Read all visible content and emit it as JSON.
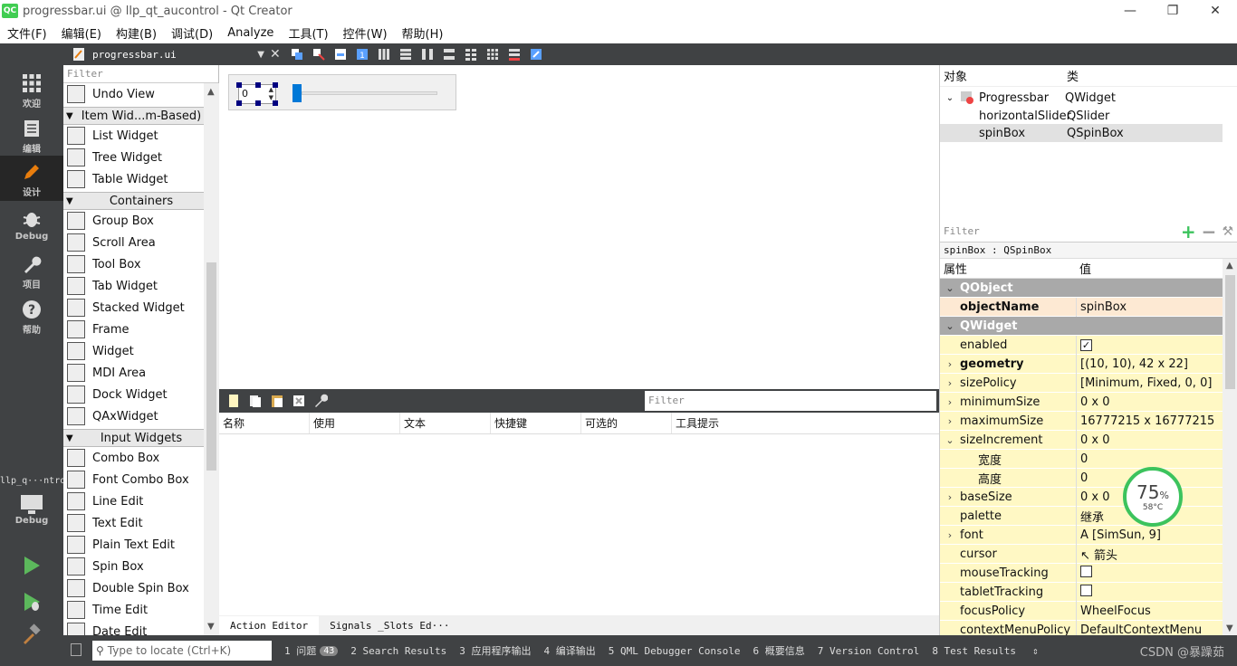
{
  "window": {
    "title": "progressbar.ui @ llp_qt_aucontrol - Qt Creator",
    "logo_text": "QC",
    "minimize_glyph": "—",
    "restore_glyph": "❐",
    "close_glyph": "✕"
  },
  "menu": [
    "文件(F)",
    "编辑(E)",
    "构建(B)",
    "调试(D)",
    "Analyze",
    "工具(T)",
    "控件(W)",
    "帮助(H)"
  ],
  "modes": [
    {
      "label": "欢迎",
      "icon": "grid-icon"
    },
    {
      "label": "编辑",
      "icon": "document-icon"
    },
    {
      "label": "设计",
      "icon": "pencil-icon",
      "active": true
    },
    {
      "label": "Debug",
      "icon": "bug-icon"
    },
    {
      "label": "项目",
      "icon": "wrench-icon"
    },
    {
      "label": "帮助",
      "icon": "help-icon"
    }
  ],
  "kit": {
    "name": "llp_q···ntrol",
    "mode": "Debug"
  },
  "toolbar": {
    "file_name": "progressbar.ui"
  },
  "widgetbox": {
    "filter_placeholder": "Filter",
    "items": [
      {
        "type": "item",
        "label": "Undo View"
      },
      {
        "type": "cat",
        "label": "Item Wid...m-Based)"
      },
      {
        "type": "item",
        "label": "List Widget"
      },
      {
        "type": "item",
        "label": "Tree Widget"
      },
      {
        "type": "item",
        "label": "Table Widget"
      },
      {
        "type": "cat",
        "label": "Containers"
      },
      {
        "type": "item",
        "label": "Group Box"
      },
      {
        "type": "item",
        "label": "Scroll Area"
      },
      {
        "type": "item",
        "label": "Tool Box"
      },
      {
        "type": "item",
        "label": "Tab Widget"
      },
      {
        "type": "item",
        "label": "Stacked Widget"
      },
      {
        "type": "item",
        "label": "Frame"
      },
      {
        "type": "item",
        "label": "Widget"
      },
      {
        "type": "item",
        "label": "MDI Area"
      },
      {
        "type": "item",
        "label": "Dock Widget"
      },
      {
        "type": "item",
        "label": "QAxWidget"
      },
      {
        "type": "cat",
        "label": "Input Widgets"
      },
      {
        "type": "item",
        "label": "Combo Box"
      },
      {
        "type": "item",
        "label": "Font Combo Box"
      },
      {
        "type": "item",
        "label": "Line Edit"
      },
      {
        "type": "item",
        "label": "Text Edit"
      },
      {
        "type": "item",
        "label": "Plain Text Edit"
      },
      {
        "type": "item",
        "label": "Spin Box"
      },
      {
        "type": "item",
        "label": "Double Spin Box"
      },
      {
        "type": "item",
        "label": "Time Edit"
      },
      {
        "type": "item",
        "label": "Date Edit"
      }
    ]
  },
  "form": {
    "spinbox_value": "0"
  },
  "action_editor": {
    "filter_placeholder": "Filter",
    "columns": [
      "名称",
      "使用",
      "文本",
      "快捷键",
      "可选的",
      "工具提示"
    ],
    "tabs": [
      "Action Editor",
      "Signals _Slots Ed···"
    ]
  },
  "object_inspector": {
    "headers": [
      "对象",
      "类"
    ],
    "rows": [
      {
        "name": "Progressbar",
        "class": "QWidget",
        "expanded": true
      },
      {
        "name": "horizontalSlider",
        "class": "QSlider"
      },
      {
        "name": "spinBox",
        "class": "QSpinBox",
        "selected": true
      }
    ]
  },
  "property_editor": {
    "filter_placeholder": "Filter",
    "class_label": "spinBox : QSpinBox",
    "headers": [
      "属性",
      "值"
    ],
    "rows": [
      {
        "kind": "group",
        "name": "QObject"
      },
      {
        "kind": "orange",
        "name": "objectName",
        "value": "spinBox",
        "bold": true
      },
      {
        "kind": "group",
        "name": "QWidget"
      },
      {
        "kind": "yellow",
        "name": "enabled",
        "check": true
      },
      {
        "kind": "yellow",
        "name": "geometry",
        "value": "[(10, 10), 42 x 22]",
        "bold": true,
        "arrow": "›"
      },
      {
        "kind": "yellow",
        "name": "sizePolicy",
        "value": "[Minimum, Fixed, 0, 0]",
        "arrow": "›"
      },
      {
        "kind": "yellow",
        "name": "minimumSize",
        "value": "0 x 0",
        "arrow": "›"
      },
      {
        "kind": "yellow",
        "name": "maximumSize",
        "value": "16777215 x 16777215",
        "arrow": "›"
      },
      {
        "kind": "yellow",
        "name": "sizeIncrement",
        "value": "0 x 0",
        "arrow": "⌄"
      },
      {
        "kind": "yellow",
        "name": "宽度",
        "value": "0",
        "indent": true
      },
      {
        "kind": "yellow",
        "name": "高度",
        "value": "0",
        "indent": true
      },
      {
        "kind": "yellow",
        "name": "baseSize",
        "value": "0 x 0",
        "arrow": "›"
      },
      {
        "kind": "yellow",
        "name": "palette",
        "value": "继承"
      },
      {
        "kind": "yellow",
        "name": "font",
        "value": "A  [SimSun, 9]",
        "arrow": "›"
      },
      {
        "kind": "yellow",
        "name": "cursor",
        "value": "↖  箭头"
      },
      {
        "kind": "yellow",
        "name": "mouseTracking",
        "check": false
      },
      {
        "kind": "yellow",
        "name": "tabletTracking",
        "check": false
      },
      {
        "kind": "yellow",
        "name": "focusPolicy",
        "value": "WheelFocus"
      },
      {
        "kind": "yellow",
        "name": "contextMenuPolicy",
        "value": "DefaultContextMenu"
      }
    ]
  },
  "statusbar": {
    "locator_placeholder": "Type to locate (Ctrl+K)",
    "items": [
      {
        "label": "1 问题",
        "badge": "43"
      },
      {
        "label": "2 Search Results"
      },
      {
        "label": "3 应用程序输出"
      },
      {
        "label": "4 编译输出"
      },
      {
        "label": "5 QML Debugger Console"
      },
      {
        "label": "6 概要信息"
      },
      {
        "label": "7 Version Control"
      },
      {
        "label": "8 Test Results"
      }
    ],
    "watermark": "CSDN @暴躁茹"
  },
  "cpu_widget": {
    "percent": "75",
    "percent_sign": "%",
    "temp": "58°C"
  },
  "colors": {
    "accent": "#0078d7",
    "dark_bar": "#404244",
    "property_yellow": "#fff8c4",
    "cpu_ring": "#3cc35d"
  }
}
